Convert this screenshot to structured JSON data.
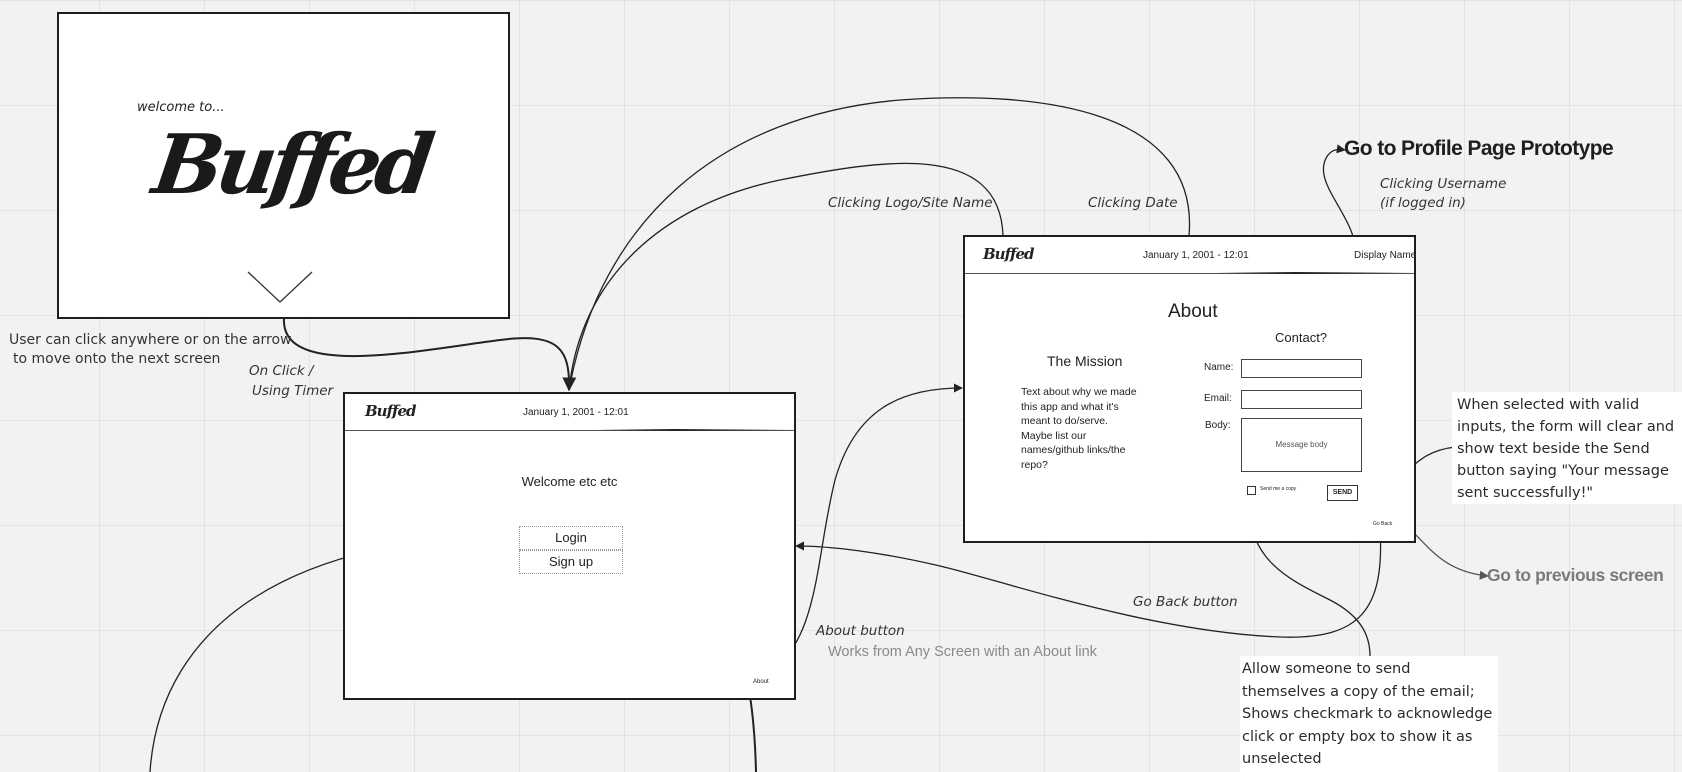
{
  "welcome": {
    "tagline": "welcome to...",
    "logo": "Buffed"
  },
  "annotations": {
    "user_click_line1": "User can click anywhere or on the arrow",
    "user_click_line2": "to move onto the next screen",
    "on_click_line1": "On Click /",
    "on_click_line2": "Using Timer",
    "clicking_logo": "Clicking Logo/Site Name",
    "clicking_date": "Clicking Date",
    "profile_link": "Go to Profile Page Prototype",
    "clicking_username_line1": "Clicking Username",
    "clicking_username_line2": "(if logged in)",
    "send_note_lines": [
      "When selected with valid",
      "inputs, the form will clear and",
      "show text beside the Send",
      "button saying \"Your message",
      "sent successfully!\""
    ],
    "previous_screen": "Go to previous screen",
    "go_back_button": "Go Back button",
    "about_button": "About button",
    "about_works": "Works from Any Screen with an About link",
    "copy_note_lines": [
      "Allow someone to send",
      "themselves a copy of the email;",
      "Shows checkmark to acknowledge",
      "click or empty box to show it as",
      "unselected"
    ]
  },
  "home_screen": {
    "logo": "Buffed",
    "date": "January 1, 2001  -  12:01",
    "welcome_text": "Welcome etc etc",
    "login_label": "Login",
    "signup_label": "Sign up",
    "about_link": "About"
  },
  "about_screen": {
    "logo": "Buffed",
    "date": "January 1, 2001  -  12:01",
    "display_name": "Display Name",
    "title": "About",
    "mission_title": "The Mission",
    "mission_lines": [
      "Text about why we made",
      "this app and what it's",
      "meant to do/serve.",
      "Maybe list our",
      "names/github links/the",
      "repo?"
    ],
    "contact_title": "Contact?",
    "name_label": "Name:",
    "email_label": "Email:",
    "body_label": "Body:",
    "body_placeholder": "Message body",
    "send_copy_label": "Send me a copy",
    "send_label": "SEND",
    "go_back_label": "Go Back"
  },
  "colors": {
    "canvas": "#f2f2f2",
    "grid": "#e3e3e3",
    "frame_border": "#1e1e1e",
    "link_heading": "#1f1f1f",
    "grey_heading": "#7a7a7a"
  }
}
